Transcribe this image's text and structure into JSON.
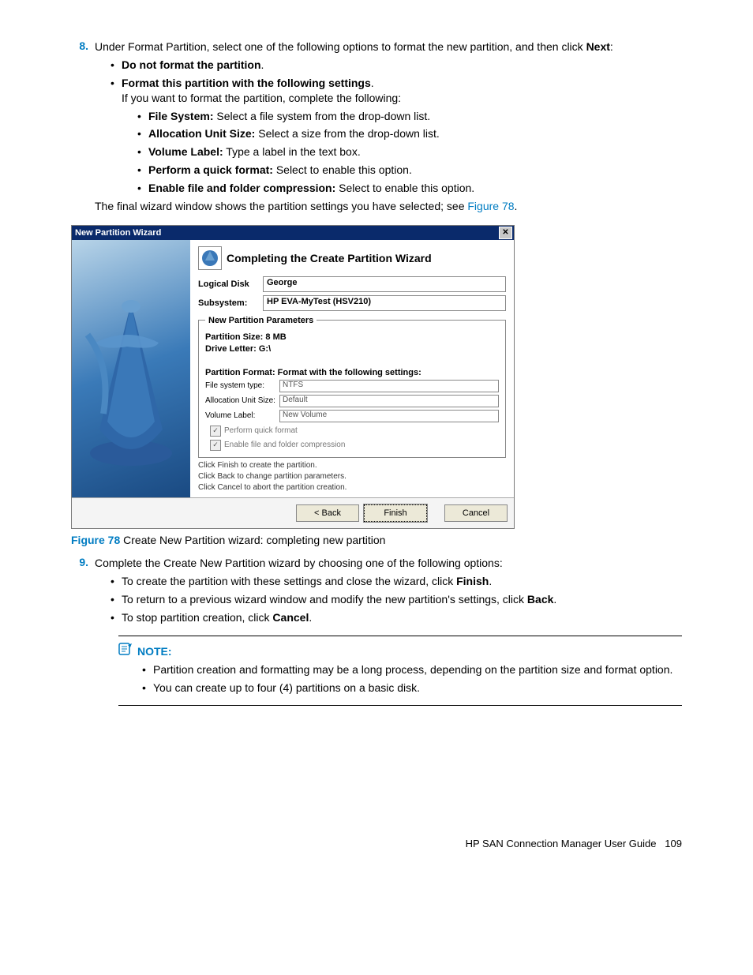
{
  "step8": {
    "num": "8.",
    "intro_a": "Under Format Partition, select one of the following options to format the new partition, and then click ",
    "intro_b": "Next",
    "intro_c": ":",
    "opt1": "Do not format the partition",
    "opt2": "Format this partition with the following settings",
    "opt2_desc": "If you want to format the partition, complete the following:",
    "fs_label": "File System:",
    "fs_desc": " Select a file system from the drop-down list.",
    "aus_label": "Allocation Unit Size:",
    "aus_desc": " Select a size from the drop-down list.",
    "vol_label": "Volume Label:",
    "vol_desc": " Type a label in the text box.",
    "quick_label": "Perform a quick format:",
    "quick_desc": " Select to enable this option.",
    "comp_label": "Enable file and folder compression:",
    "comp_desc": " Select to enable this option.",
    "final_a": "The final wizard window shows the partition settings you have selected; see ",
    "final_link": "Figure 78",
    "final_b": "."
  },
  "wizard": {
    "title": "New Partition Wizard",
    "close": "✕",
    "heading": "Completing the Create Partition Wizard",
    "logical_disk_label": "Logical Disk",
    "logical_disk_value": "George",
    "subsystem_label": "Subsystem:",
    "subsystem_value": "HP EVA-MyTest (HSV210)",
    "legend": "New Partition Parameters",
    "size": "Partition Size: 8 MB",
    "drive": "Drive Letter: G:\\",
    "format_heading": "Partition Format: Format with the following settings:",
    "fstype_label": "File system type:",
    "fstype_value": "NTFS",
    "aus_label": "Allocation Unit Size:",
    "aus_value": "Default",
    "vol_label": "Volume Label:",
    "vol_value": "New Volume",
    "quick_cb": "Perform quick format",
    "comp_cb": "Enable file and folder compression",
    "hint1": "Click Finish to create the partition.",
    "hint2": "Click Back to change partition parameters.",
    "hint3": "Click Cancel to abort the partition creation.",
    "btn_back": "< Back",
    "btn_finish": "Finish",
    "btn_cancel": "Cancel"
  },
  "figure": {
    "num": "Figure 78",
    "caption": " Create New Partition wizard: completing new partition"
  },
  "step9": {
    "num": "9.",
    "intro": "Complete the Create New Partition wizard by choosing one of the following options:",
    "opt1_a": "To create the partition with these settings and close the wizard, click ",
    "opt1_b": "Finish",
    "opt1_c": ".",
    "opt2_a": "To return to a previous wizard window and modify the new partition's settings, click ",
    "opt2_b": "Back",
    "opt2_c": ".",
    "opt3_a": "To stop partition creation, click ",
    "opt3_b": "Cancel",
    "opt3_c": "."
  },
  "note": {
    "label": "NOTE:",
    "item1": "Partition creation and formatting may be a long process, depending on the partition size and format option.",
    "item2": "You can create up to four (4) partitions on a basic disk."
  },
  "footer": {
    "text": "HP SAN Connection Manager User Guide",
    "page": "109"
  }
}
